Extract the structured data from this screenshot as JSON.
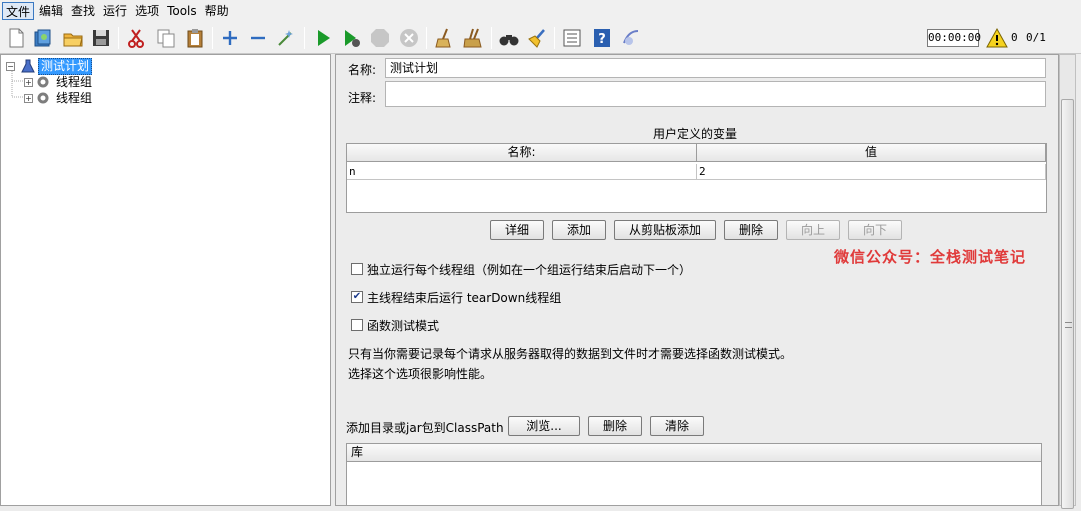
{
  "menu": [
    {
      "label": "文件",
      "active": true
    },
    {
      "label": "编辑"
    },
    {
      "label": "查找"
    },
    {
      "label": "运行"
    },
    {
      "label": "选项"
    },
    {
      "label": "Tools"
    },
    {
      "label": "帮助"
    }
  ],
  "status": {
    "timer": "00:00:00",
    "warnings": "0",
    "threads": "0/1"
  },
  "tree": {
    "root": "测试计划",
    "children": [
      "线程组",
      "线程组"
    ]
  },
  "form": {
    "name_label": "名称:",
    "name_value": "测试计划",
    "comment_label": "注释:",
    "comment_value": ""
  },
  "variables": {
    "title": "用户定义的变量",
    "headers": [
      "名称:",
      "值"
    ],
    "rows": [
      [
        "n",
        "2"
      ]
    ],
    "buttons": {
      "detail": "详细",
      "add": "添加",
      "add_clipboard": "从剪贴板添加",
      "delete": "删除",
      "up": "向上",
      "down": "向下"
    }
  },
  "options": {
    "independent": {
      "label": "独立运行每个线程组（例如在一个组运行结束后启动下一个）",
      "checked": false
    },
    "teardown": {
      "label": "主线程结束后运行 tearDown线程组",
      "checked": true
    },
    "functional": {
      "label": "函数测试模式",
      "checked": false
    },
    "note_line1": "只有当你需要记录每个请求从服务器取得的数据到文件时才需要选择函数测试模式。",
    "note_line2": "选择这个选项很影响性能。"
  },
  "classpath": {
    "label": "添加目录或jar包到ClassPath",
    "browse": "浏览...",
    "delete": "删除",
    "clear": "清除",
    "lib_header": "库"
  },
  "watermark": "微信公众号：全栈测试笔记",
  "colors": {
    "selection": "#3399ff",
    "watermark": "#e03a3a",
    "run_green": "#1a9a2a"
  }
}
